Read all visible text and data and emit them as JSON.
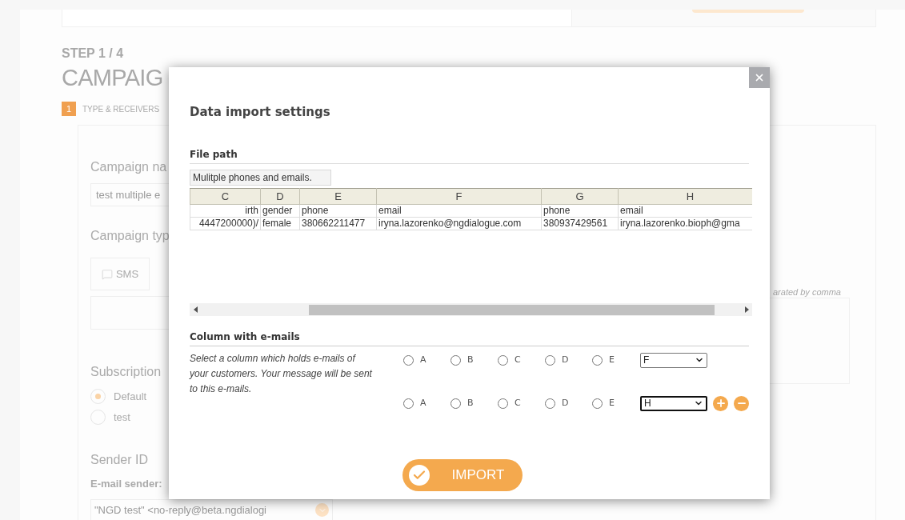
{
  "background": {
    "step": "STEP 1 / 4",
    "title": "CAMPAIG",
    "stepper": [
      {
        "number": "1",
        "label": "TYPE & RECEIVERS",
        "selected": true
      }
    ],
    "campaign_name": {
      "label": "Campaign na",
      "value": "test multiple e"
    },
    "campaign_type": {
      "label": "Campaign typ",
      "options": [
        {
          "label": "SMS",
          "selected": false
        }
      ]
    },
    "subscription": {
      "label": "Subscription",
      "options": [
        {
          "label": "Default",
          "selected": true
        },
        {
          "label": "test",
          "selected": false
        }
      ]
    },
    "sender": {
      "label": "Sender ID",
      "field_label": "E-mail sender:",
      "value": "\"NGD test\" <no-reply@beta.ngdialogi"
    },
    "hint": "arated by comma"
  },
  "modal": {
    "title": "Data import settings",
    "file_path": {
      "label": "File path",
      "value": "Mulitple phones and emails."
    },
    "table": {
      "columns": [
        "C",
        "D",
        "E",
        "F",
        "G",
        "H"
      ],
      "rows": [
        [
          "irth",
          "gender",
          "phone",
          "email",
          "phone",
          "email"
        ],
        [
          "4447200000)/",
          "female",
          "380662211477",
          "iryna.lazorenko@ngdialogue.com",
          "380937429561",
          "iryna.lazorenko.bioph@gma"
        ]
      ]
    },
    "email_columns": {
      "label": "Column with e-mails",
      "description": "Select a column which holds e-mails of your customers. Your message will be sent to this e-mails.",
      "rows": [
        {
          "options": [
            {
              "label": "A",
              "selected": false
            },
            {
              "label": "B",
              "selected": false
            },
            {
              "label": "C",
              "selected": false
            },
            {
              "label": "D",
              "selected": false
            },
            {
              "label": "E",
              "selected": false
            }
          ],
          "select": "F",
          "focused": false,
          "actions": false
        },
        {
          "options": [
            {
              "label": "A",
              "selected": false
            },
            {
              "label": "B",
              "selected": false
            },
            {
              "label": "C",
              "selected": false
            },
            {
              "label": "D",
              "selected": false
            },
            {
              "label": "E",
              "selected": false
            }
          ],
          "select": "H",
          "focused": true,
          "actions": true
        }
      ]
    },
    "import_button": "IMPORT"
  }
}
